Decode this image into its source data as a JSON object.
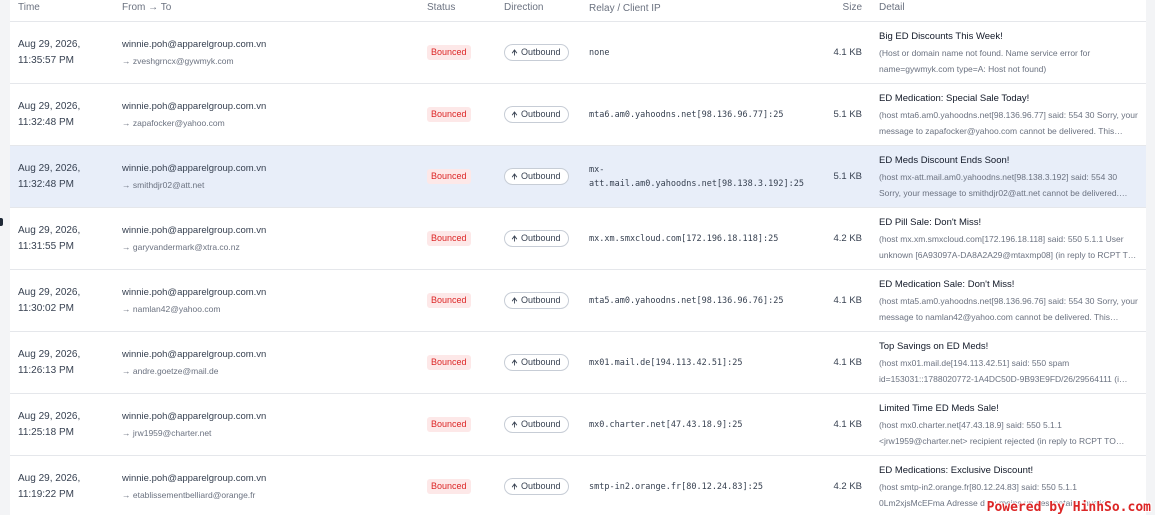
{
  "columns": {
    "time": "Time",
    "from_to": "From → To",
    "status": "Status",
    "direction": "Direction",
    "relay": "Relay / Client IP",
    "size": "Size",
    "detail": "Detail"
  },
  "rows": [
    {
      "date": "Aug 29, 2026,",
      "time": "11:35:57 PM",
      "from": "winnie.poh@apparelgroup.com.vn",
      "to": "→ zveshgrncx@gywmyk.com",
      "status": "Bounced",
      "direction": "Outbound",
      "relay": "none",
      "size": "4.1 KB",
      "subject": "Big ED Discounts This Week!",
      "message": "(Host or domain name not found. Name service error for name=gywmyk.com type=A: Host not found)"
    },
    {
      "date": "Aug 29, 2026,",
      "time": "11:32:48 PM",
      "from": "winnie.poh@apparelgroup.com.vn",
      "to": "→ zapafocker@yahoo.com",
      "status": "Bounced",
      "direction": "Outbound",
      "relay": "mta6.am0.yahoodns.net[98.136.96.77]:25",
      "size": "5.1 KB",
      "subject": "ED Medication: Special Sale Today!",
      "message": "(host mta6.am0.yahoodns.net[98.136.96.77] said: 554 30 Sorry, your message to zapafocker@yahoo.com cannot be delivered. This…"
    },
    {
      "date": "Aug 29, 2026,",
      "time": "11:32:48 PM",
      "from": "winnie.poh@apparelgroup.com.vn",
      "to": "→ smithdjr02@att.net",
      "status": "Bounced",
      "direction": "Outbound",
      "relay": "mx-att.mail.am0.yahoodns.net[98.138.3.192]:25",
      "size": "5.1 KB",
      "subject": "ED Meds Discount Ends Soon!",
      "message": "(host mx-att.mail.am0.yahoodns.net[98.138.3.192] said: 554 30 Sorry, your message to smithdjr02@att.net cannot be delivered. Thi…"
    },
    {
      "date": "Aug 29, 2026,",
      "time": "11:31:55 PM",
      "from": "winnie.poh@apparelgroup.com.vn",
      "to": "→ garyvandermark@xtra.co.nz",
      "status": "Bounced",
      "direction": "Outbound",
      "relay": "mx.xm.smxcloud.com[172.196.18.118]:25",
      "size": "4.2 KB",
      "subject": "ED Pill Sale: Don't Miss!",
      "message": "(host mx.xm.smxcloud.com[172.196.18.118] said: 550 5.1.1 User unknown [6A93097A-DA8A2A29@mtaxmp08] (in reply to RCPT T…"
    },
    {
      "date": "Aug 29, 2026,",
      "time": "11:30:02 PM",
      "from": "winnie.poh@apparelgroup.com.vn",
      "to": "→ namlan42@yahoo.com",
      "status": "Bounced",
      "direction": "Outbound",
      "relay": "mta5.am0.yahoodns.net[98.136.96.76]:25",
      "size": "4.1 KB",
      "subject": "ED Medication Sale: Don't Miss!",
      "message": "(host mta5.am0.yahoodns.net[98.136.96.76] said: 554 30 Sorry, your message to namlan42@yahoo.com cannot be delivered. This…"
    },
    {
      "date": "Aug 29, 2026,",
      "time": "11:26:13 PM",
      "from": "winnie.poh@apparelgroup.com.vn",
      "to": "→ andre.goetze@mail.de",
      "status": "Bounced",
      "direction": "Outbound",
      "relay": "mx01.mail.de[194.113.42.51]:25",
      "size": "4.1 KB",
      "subject": "Top Savings on ED Meds!",
      "message": "(host mx01.mail.de[194.113.42.51] said: 550 spam id=153031::1788020772-1A4DC50D-9B93E9FD/26/29564111 (i…"
    },
    {
      "date": "Aug 29, 2026,",
      "time": "11:25:18 PM",
      "from": "winnie.poh@apparelgroup.com.vn",
      "to": "→ jrw1959@charter.net",
      "status": "Bounced",
      "direction": "Outbound",
      "relay": "mx0.charter.net[47.43.18.9]:25",
      "size": "4.1 KB",
      "subject": "Limited Time ED Meds Sale!",
      "message": "(host mx0.charter.net[47.43.18.9] said: 550 5.1.1 <jrw1959@charter.net> recipient rejected (in reply to RCPT TO…"
    },
    {
      "date": "Aug 29, 2026,",
      "time": "11:19:22 PM",
      "from": "winnie.poh@apparelgroup.com.vn",
      "to": "→ etablissementbelliard@orange.fr",
      "status": "Bounced",
      "direction": "Outbound",
      "relay": "smtp-in2.orange.fr[80.12.24.83]:25",
      "size": "4.2 KB",
      "subject": "ED Medications: Exclusive Discount!",
      "message": "(host smtp-in2.orange.fr[80.12.24.83] said: 550 5.1.1 0Lm2xjsMcEFma Adresse d au moins un destinataire invalide…"
    }
  ],
  "selected_row": 2,
  "watermark": "Powered by HinhSo.com",
  "colors": {
    "bounced_bg": "#fde8e8",
    "bounced_text": "#dc2626",
    "selected_row_bg": "#e8eef9"
  }
}
